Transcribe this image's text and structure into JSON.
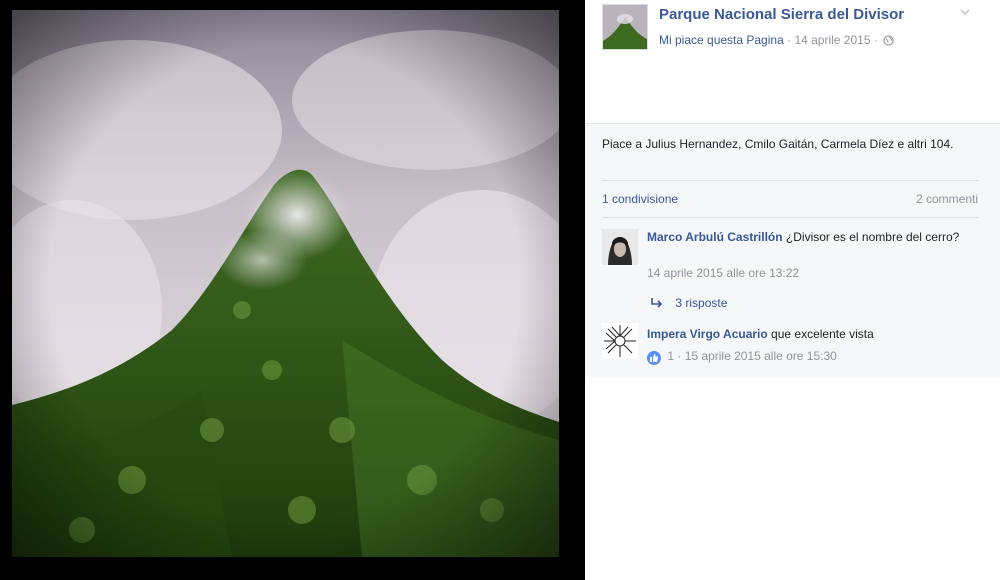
{
  "post": {
    "page_name": "Parque Nacional Sierra del Divisor",
    "like_page": "Mi piace questa Pagina",
    "separator": "·",
    "date": "14 aprile 2015",
    "privacy_icon": "globe-icon",
    "options_icon": "chevron-down-icon"
  },
  "feedback": {
    "likes_text": "Piace a Julius Hernandez, Cmilo Gaitán, Carmela Díez e altri 104.",
    "shares": "1 condivisione",
    "comments_count": "2 commenti"
  },
  "comments": [
    {
      "author": "Marco Arbulú Castrillón",
      "text": "¿Divisor es el nombre del cerro?",
      "time": "14 aprile 2015 alle ore 13:22",
      "replies": "3 risposte",
      "reply_icon": "reply-arrow-icon"
    },
    {
      "author": "Impera Virgo Acuario",
      "text": "que excelente vista",
      "like_count": "1",
      "separator": "·",
      "time": "15 aprile 2015 alle ore 15:30",
      "like_icon": "thumbs-up-icon"
    }
  ],
  "colors": {
    "brand_link": "#3b5998",
    "comment_author": "#365899",
    "meta_gray": "#90949c",
    "feedback_bg": "#f6f7f9",
    "like_badge": "#5890ff"
  }
}
